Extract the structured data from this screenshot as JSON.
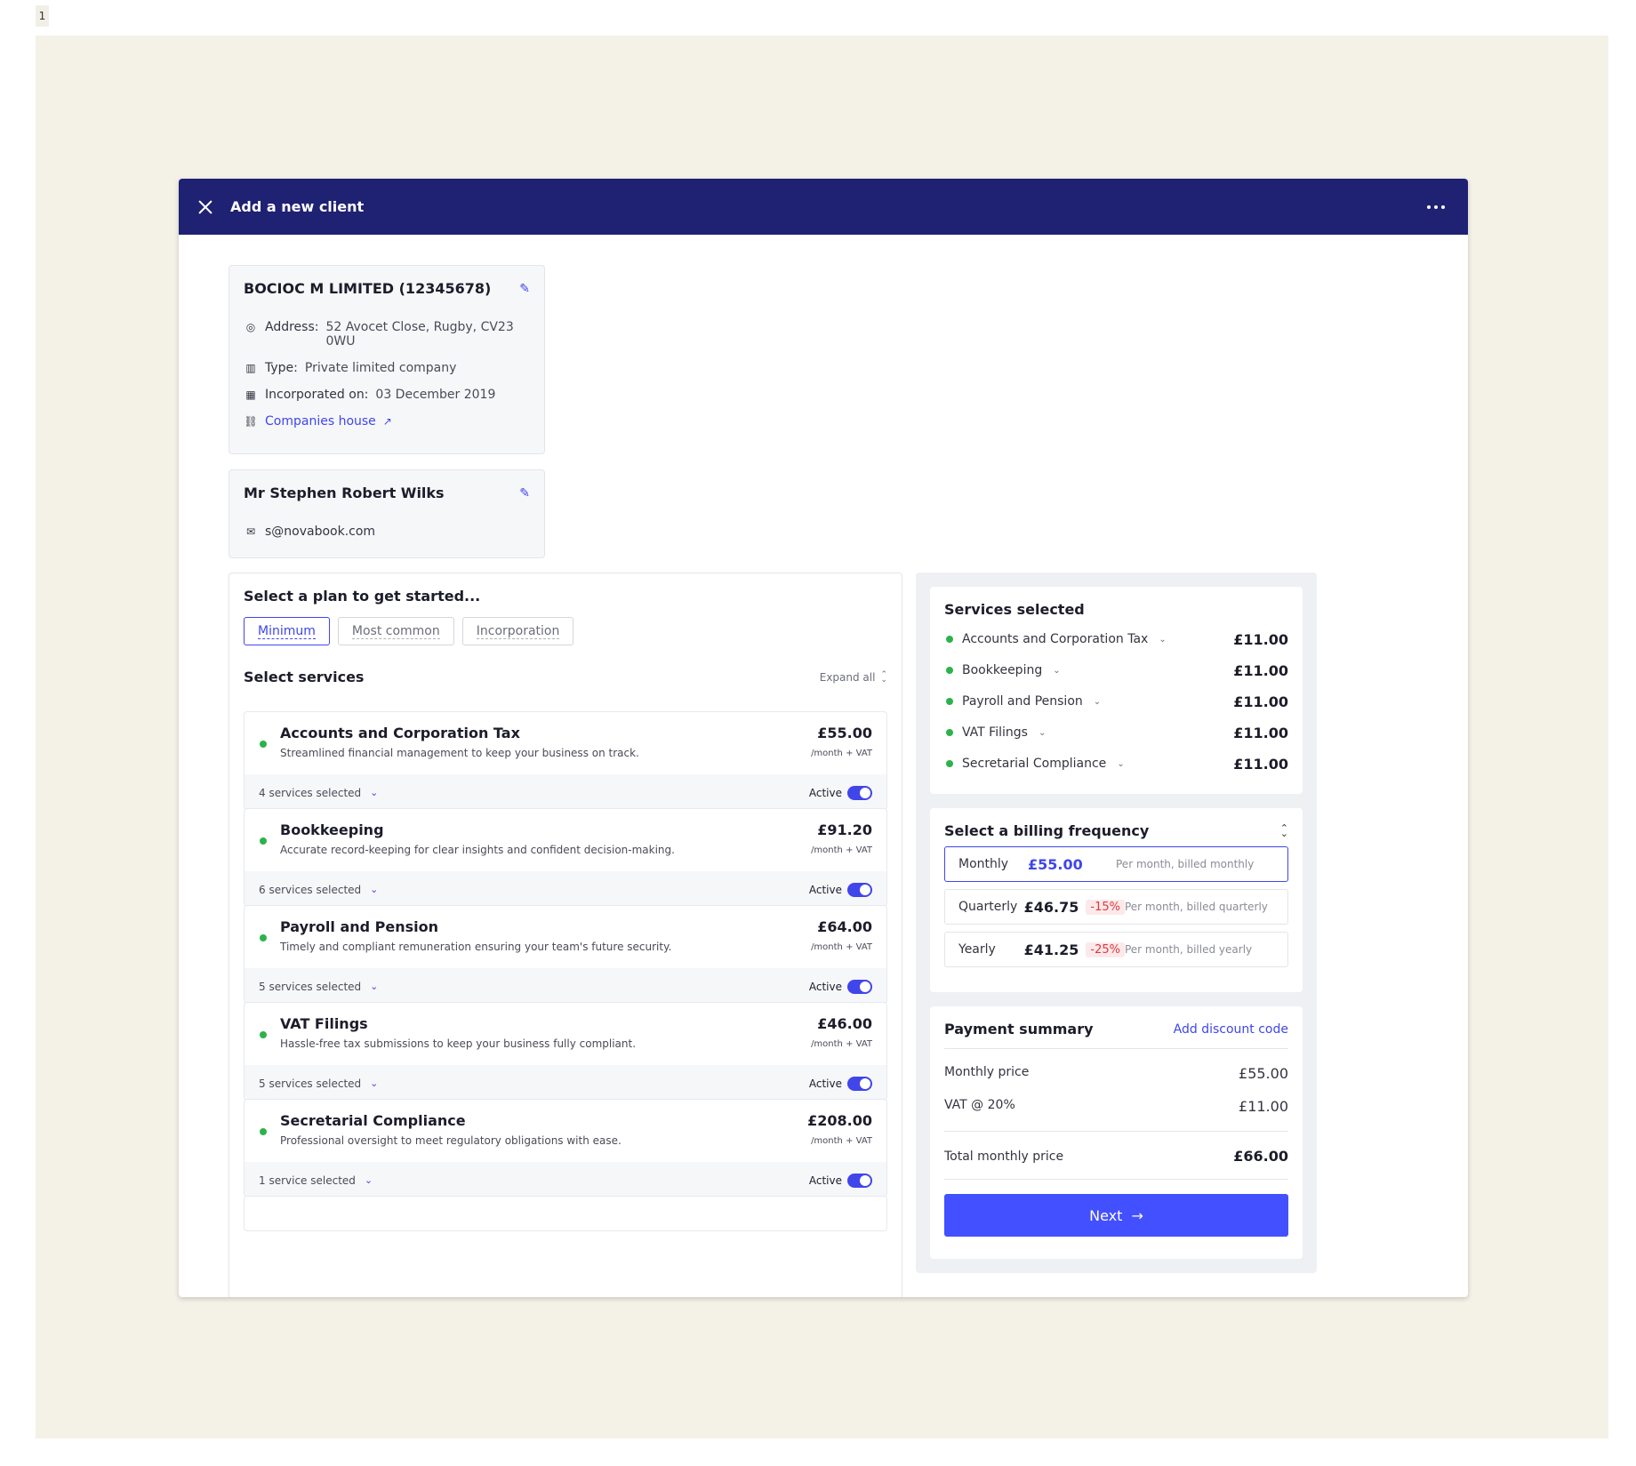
{
  "page_number": "1",
  "modal": {
    "title": "Add a new client"
  },
  "company": {
    "name": "BOCIOC M LIMITED (12345678)",
    "address_label": "Address:",
    "address": "52 Avocet Close, Rugby, CV23 0WU",
    "type_label": "Type:",
    "type": "Private limited company",
    "incorporated_label": "Incorporated on:",
    "incorporated": "03 December 2019",
    "link": "Companies house"
  },
  "person": {
    "name": "Mr Stephen Robert Wilks",
    "email": "s@novabook.com"
  },
  "plans": {
    "title": "Select a plan to get started...",
    "tabs": [
      "Minimum",
      "Most common",
      "Incorporation"
    ],
    "active_tab": "Minimum"
  },
  "services": {
    "title": "Select services",
    "expand_all": "Expand all",
    "items": [
      {
        "name": "Accounts and Corporation Tax",
        "desc": "Streamlined financial management to keep your business on track.",
        "price": "£55.00",
        "per": "/month + VAT",
        "count": "4 services selected",
        "status": "Active"
      },
      {
        "name": "Bookkeeping",
        "desc": "Accurate record-keeping for clear insights and confident decision-making.",
        "price": "£91.20",
        "per": "/month + VAT",
        "count": "6 services selected",
        "status": "Active"
      },
      {
        "name": "Payroll and Pension",
        "desc": "Timely and compliant remuneration ensuring your team's future security.",
        "price": "£64.00",
        "per": "/month + VAT",
        "count": "5 services selected",
        "status": "Active"
      },
      {
        "name": "VAT Filings",
        "desc": "Hassle-free tax submissions to keep your business fully compliant.",
        "price": "£46.00",
        "per": "/month + VAT",
        "count": "5 services selected",
        "status": "Active"
      },
      {
        "name": "Secretarial Compliance",
        "desc": "Professional oversight to meet regulatory obligations with ease.",
        "price": "£208.00",
        "per": "/month + VAT",
        "count": "1 service selected",
        "status": "Active"
      }
    ]
  },
  "selected": {
    "title": "Services selected",
    "items": [
      {
        "name": "Accounts and Corporation Tax",
        "price": "£11.00"
      },
      {
        "name": "Bookkeeping",
        "price": "£11.00"
      },
      {
        "name": "Payroll and Pension",
        "price": "£11.00"
      },
      {
        "name": "VAT Filings",
        "price": "£11.00"
      },
      {
        "name": "Secretarial Compliance",
        "price": "£11.00"
      }
    ]
  },
  "billing": {
    "title": "Select a billing frequency",
    "options": [
      {
        "label": "Monthly",
        "amount": "£55.00",
        "discount": "",
        "desc": "Per month, billed monthly"
      },
      {
        "label": "Quarterly",
        "amount": "£46.75",
        "discount": "-15%",
        "desc": "Per month, billed quarterly"
      },
      {
        "label": "Yearly",
        "amount": "£41.25",
        "discount": "-25%",
        "desc": "Per month, billed yearly"
      }
    ],
    "selected": "Monthly"
  },
  "payment": {
    "title": "Payment summary",
    "discount_link": "Add discount code",
    "monthly_label": "Monthly price",
    "monthly_value": "£55.00",
    "vat_label": "VAT @ 20%",
    "vat_value": "£11.00",
    "total_label": "Total monthly price",
    "total_value": "£66.00",
    "next_label": "Next"
  },
  "colors": {
    "header": "#1f2173",
    "accent": "#4046ea",
    "active_dot": "#2bb34b",
    "discount": "#e0383e"
  }
}
